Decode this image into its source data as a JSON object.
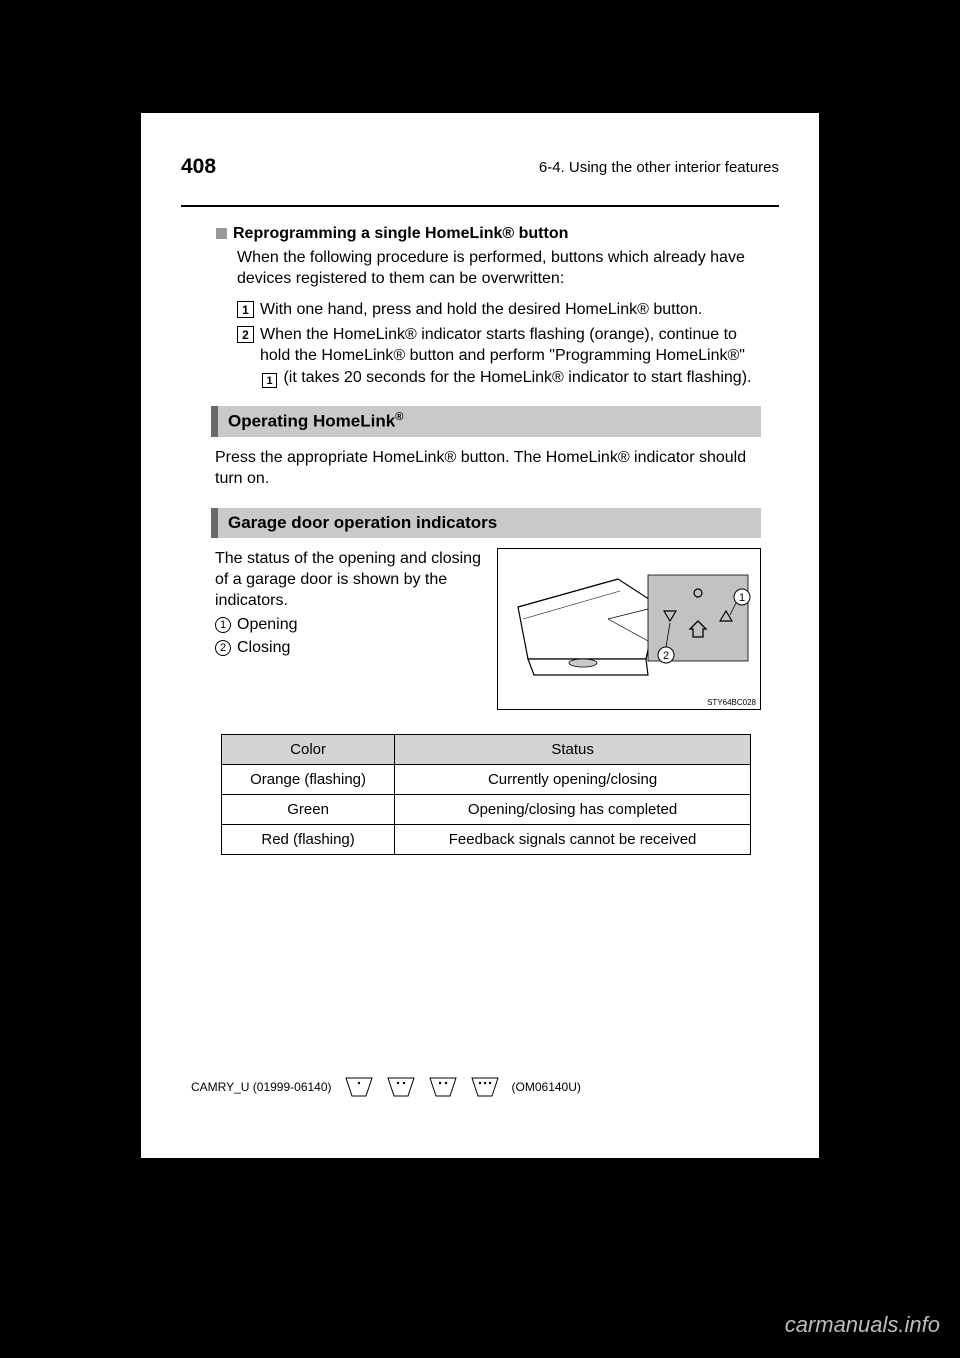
{
  "header": {
    "page_number": "408",
    "section": "6-4. Using the other interior features"
  },
  "reprogramming": {
    "marker": "square",
    "title": "Reprogramming a single HomeLink® button",
    "intro": "When the following procedure is performed, buttons which already have devices registered to them can be overwritten:",
    "steps": [
      "With one hand, press and hold the desired HomeLink® button.",
      "When the HomeLink® indicator starts flashing (orange), continue to hold the HomeLink® button and perform \"Programming HomeLink®\" "
    ],
    "step_suffix_pre": "(it takes 20 seconds for the HomeLink® indicator to start flashing).",
    "one": "1"
  },
  "operating": {
    "title_pre": "Operating HomeLink",
    "title_sup": "®",
    "body": "Press the appropriate HomeLink® button. The HomeLink® indicator should turn on."
  },
  "indicators": {
    "title": "Garage door operation indicators",
    "lead": "The status of the opening and closing of a garage door is shown by the indicators.",
    "items": [
      "Opening",
      "Closing"
    ],
    "illus_ref": "STY64BC028",
    "callouts": [
      "1",
      "2"
    ]
  },
  "table": {
    "headers": [
      "Color",
      "Status"
    ],
    "rows": [
      [
        "Orange (flashing)",
        "Currently opening/closing"
      ],
      [
        "Green",
        "Opening/closing has completed"
      ],
      [
        "Red (flashing)",
        "Feedback signals cannot be received"
      ]
    ]
  },
  "footer": {
    "code": "CAMRY_U (01999-06140)",
    "date": "(OM06140U)"
  },
  "watermark": "carmanuals.info"
}
